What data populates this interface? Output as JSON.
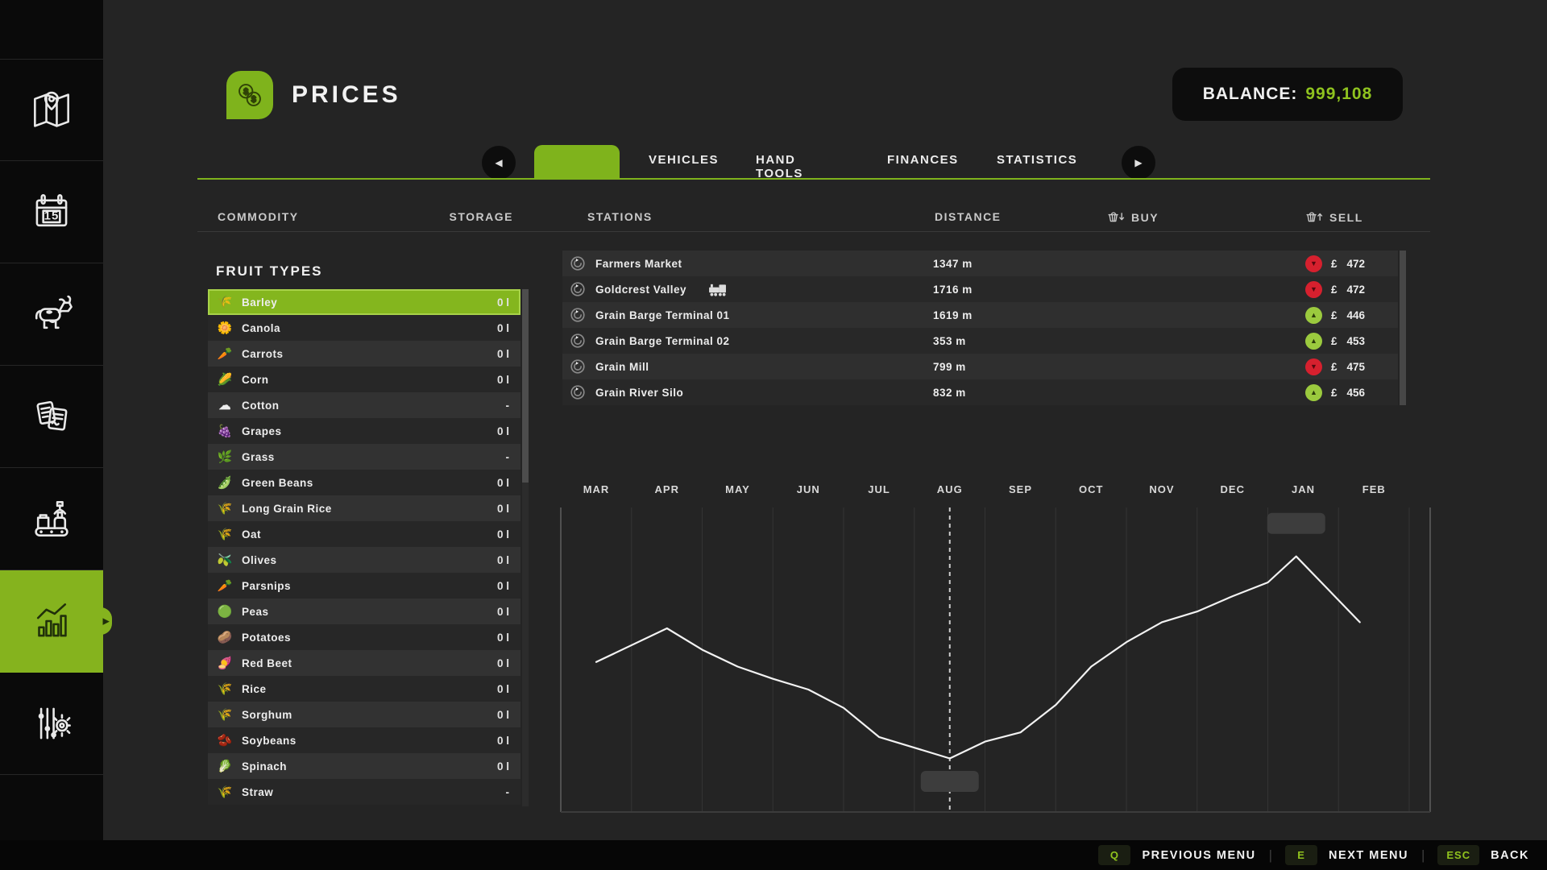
{
  "header": {
    "title": "PRICES",
    "icon": "coins-icon",
    "balance_label": "BALANCE:",
    "balance_value": "999,108"
  },
  "tab_bar": {
    "prev_arrow": "◀",
    "next_arrow": "▶",
    "tabs": [
      {
        "label": "",
        "active": true
      },
      {
        "label": "VEHICLES",
        "active": false
      },
      {
        "label": "HAND TOOLS",
        "active": false
      },
      {
        "label": "FINANCES",
        "active": false
      },
      {
        "label": "STATISTICS",
        "active": false
      }
    ]
  },
  "table_header": {
    "commodity": "COMMODITY",
    "storage": "STORAGE",
    "stations": "STATIONS",
    "distance": "DISTANCE",
    "buy": "BUY",
    "sell": "SELL"
  },
  "fruit_panel": {
    "title": "FRUIT TYPES",
    "items": [
      {
        "name": "Barley",
        "icon": "🌾",
        "storage": "0 l",
        "selected": true
      },
      {
        "name": "Canola",
        "icon": "🌼",
        "storage": "0 l",
        "selected": false
      },
      {
        "name": "Carrots",
        "icon": "🥕",
        "storage": "0 l",
        "selected": false
      },
      {
        "name": "Corn",
        "icon": "🌽",
        "storage": "0 l",
        "selected": false
      },
      {
        "name": "Cotton",
        "icon": "☁",
        "storage": "-",
        "selected": false
      },
      {
        "name": "Grapes",
        "icon": "🍇",
        "storage": "0 l",
        "selected": false
      },
      {
        "name": "Grass",
        "icon": "🌿",
        "storage": "-",
        "selected": false
      },
      {
        "name": "Green Beans",
        "icon": "🫛",
        "storage": "0 l",
        "selected": false
      },
      {
        "name": "Long Grain Rice",
        "icon": "🌾",
        "storage": "0 l",
        "selected": false
      },
      {
        "name": "Oat",
        "icon": "🌾",
        "storage": "0 l",
        "selected": false
      },
      {
        "name": "Olives",
        "icon": "🫒",
        "storage": "0 l",
        "selected": false
      },
      {
        "name": "Parsnips",
        "icon": "🥕",
        "storage": "0 l",
        "selected": false
      },
      {
        "name": "Peas",
        "icon": "🟢",
        "storage": "0 l",
        "selected": false
      },
      {
        "name": "Potatoes",
        "icon": "🥔",
        "storage": "0 l",
        "selected": false
      },
      {
        "name": "Red Beet",
        "icon": "🍠",
        "storage": "0 l",
        "selected": false
      },
      {
        "name": "Rice",
        "icon": "🌾",
        "storage": "0 l",
        "selected": false
      },
      {
        "name": "Sorghum",
        "icon": "🌾",
        "storage": "0 l",
        "selected": false
      },
      {
        "name": "Soybeans",
        "icon": "🫘",
        "storage": "0 l",
        "selected": false
      },
      {
        "name": "Spinach",
        "icon": "🥬",
        "storage": "0 l",
        "selected": false
      },
      {
        "name": "Straw",
        "icon": "🌾",
        "storage": "-",
        "selected": false
      }
    ]
  },
  "stations_panel": {
    "trend_glyphs": {
      "up": "▲",
      "down": "▼"
    },
    "rows": [
      {
        "name": "Farmers Market",
        "distance": "1347 m",
        "currency": "£",
        "sell": "472",
        "trend": "down",
        "train": false
      },
      {
        "name": "Goldcrest Valley",
        "distance": "1716 m",
        "currency": "£",
        "sell": "472",
        "trend": "down",
        "train": true
      },
      {
        "name": "Grain Barge Terminal 01",
        "distance": "1619 m",
        "currency": "£",
        "sell": "446",
        "trend": "up",
        "train": false
      },
      {
        "name": "Grain Barge Terminal 02",
        "distance": "353 m",
        "currency": "£",
        "sell": "453",
        "trend": "up",
        "train": false
      },
      {
        "name": "Grain Mill",
        "distance": "799 m",
        "currency": "£",
        "sell": "475",
        "trend": "down",
        "train": false
      },
      {
        "name": "Grain River Silo",
        "distance": "832 m",
        "currency": "£",
        "sell": "456",
        "trend": "up",
        "train": false
      }
    ]
  },
  "chart_data": {
    "type": "line",
    "title": "",
    "x_labels": [
      "MAR",
      "APR",
      "MAY",
      "JUN",
      "JUL",
      "AUG",
      "SEP",
      "OCT",
      "NOV",
      "DEC",
      "JAN",
      "FEB"
    ],
    "axis_note": "x in month units (0 = MAR center, 11 = FEB center); level is relative price height, 0 = chart bottom, 1 = chart top; no y-axis labels shown in game",
    "grid": "vertical-monthly",
    "legend": "none",
    "series": [
      {
        "name": "barley-sell-price-trend",
        "color": "#f2f2f2",
        "points": [
          {
            "x": 0.0,
            "level": 0.49
          },
          {
            "x": 1.0,
            "level": 0.6
          },
          {
            "x": 1.5,
            "level": 0.53
          },
          {
            "x": 2.0,
            "level": 0.475
          },
          {
            "x": 2.5,
            "level": 0.435
          },
          {
            "x": 3.0,
            "level": 0.4
          },
          {
            "x": 3.5,
            "level": 0.34
          },
          {
            "x": 4.0,
            "level": 0.245
          },
          {
            "x": 4.5,
            "level": 0.21
          },
          {
            "x": 5.0,
            "level": 0.175
          },
          {
            "x": 5.5,
            "level": 0.23
          },
          {
            "x": 6.0,
            "level": 0.26
          },
          {
            "x": 6.5,
            "level": 0.35
          },
          {
            "x": 7.0,
            "level": 0.475
          },
          {
            "x": 7.5,
            "level": 0.555
          },
          {
            "x": 8.0,
            "level": 0.62
          },
          {
            "x": 8.5,
            "level": 0.655
          },
          {
            "x": 9.0,
            "level": 0.705
          },
          {
            "x": 9.5,
            "level": 0.75
          },
          {
            "x": 9.9,
            "level": 0.835
          },
          {
            "x": 10.8,
            "level": 0.62
          }
        ]
      }
    ],
    "current_time_marker": {
      "x": 5.0,
      "month": "AUG",
      "style": "dashed-vertical-line"
    },
    "annotations": [
      {
        "type": "empty-label-box",
        "anchor": "line-minimum",
        "x": 5.0,
        "text": ""
      },
      {
        "type": "empty-label-box",
        "anchor": "line-maximum",
        "x": 9.9,
        "text": ""
      }
    ]
  },
  "footer": {
    "separator": "|",
    "shortcuts": [
      {
        "key": "Q",
        "label": "PREVIOUS MENU"
      },
      {
        "key": "E",
        "label": "NEXT MENU"
      },
      {
        "key": "ESC",
        "label": "BACK"
      }
    ]
  },
  "sidebar": {
    "items": [
      {
        "id": "map",
        "icon": "map",
        "active": false
      },
      {
        "id": "calendar",
        "icon": "calendar",
        "day": "15",
        "active": false
      },
      {
        "id": "animals",
        "icon": "animals",
        "active": false
      },
      {
        "id": "contracts",
        "icon": "contracts",
        "active": false
      },
      {
        "id": "production",
        "icon": "production",
        "active": false
      },
      {
        "id": "statistics",
        "icon": "statistics",
        "active": true
      },
      {
        "id": "settings",
        "icon": "settings",
        "active": false
      }
    ]
  },
  "colors": {
    "accent_green": "#7fb31c",
    "balance_green": "#8fc31f",
    "selected_row_green": "#84b61e",
    "sell_up_green": "#9bca3e",
    "sell_down_red": "#d6202e",
    "page_background": "#242424",
    "sidebar_background": "#0a0a0a"
  }
}
